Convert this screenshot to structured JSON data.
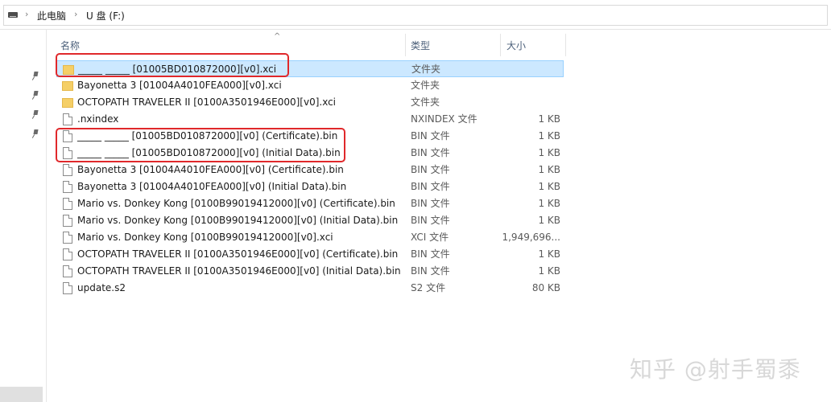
{
  "address": {
    "crumbs": [
      "此电脑",
      "U 盘 (F:)"
    ]
  },
  "columns": {
    "name": "名称",
    "type": "类型",
    "size": "大小"
  },
  "files": [
    {
      "name": "_____ _____ [01005BD010872000][v0].xci",
      "type": "文件夹",
      "size": "",
      "kind": "folder",
      "selected": true
    },
    {
      "name": "Bayonetta 3 [01004A4010FEA000][v0].xci",
      "type": "文件夹",
      "size": "",
      "kind": "folder"
    },
    {
      "name": "OCTOPATH TRAVELER II [0100A3501946E000][v0].xci",
      "type": "文件夹",
      "size": "",
      "kind": "folder"
    },
    {
      "name": ".nxindex",
      "type": "NXINDEX 文件",
      "size": "1 KB",
      "kind": "file"
    },
    {
      "name": "_____ _____ [01005BD010872000][v0] (Certificate).bin",
      "type": "BIN 文件",
      "size": "1 KB",
      "kind": "file"
    },
    {
      "name": "_____ _____ [01005BD010872000][v0] (Initial Data).bin",
      "type": "BIN 文件",
      "size": "1 KB",
      "kind": "file"
    },
    {
      "name": "Bayonetta 3 [01004A4010FEA000][v0] (Certificate).bin",
      "type": "BIN 文件",
      "size": "1 KB",
      "kind": "file"
    },
    {
      "name": "Bayonetta 3 [01004A4010FEA000][v0] (Initial Data).bin",
      "type": "BIN 文件",
      "size": "1 KB",
      "kind": "file"
    },
    {
      "name": "Mario vs. Donkey Kong [0100B99019412000][v0] (Certificate).bin",
      "type": "BIN 文件",
      "size": "1 KB",
      "kind": "file"
    },
    {
      "name": "Mario vs. Donkey Kong [0100B99019412000][v0] (Initial Data).bin",
      "type": "BIN 文件",
      "size": "1 KB",
      "kind": "file"
    },
    {
      "name": "Mario vs. Donkey Kong [0100B99019412000][v0].xci",
      "type": "XCI 文件",
      "size": "1,949,696...",
      "kind": "file"
    },
    {
      "name": "OCTOPATH TRAVELER II [0100A3501946E000][v0] (Certificate).bin",
      "type": "BIN 文件",
      "size": "1 KB",
      "kind": "file"
    },
    {
      "name": "OCTOPATH TRAVELER II [0100A3501946E000][v0] (Initial Data).bin",
      "type": "BIN 文件",
      "size": "1 KB",
      "kind": "file"
    },
    {
      "name": "update.s2",
      "type": "S2 文件",
      "size": "80 KB",
      "kind": "file"
    }
  ],
  "watermark": "知乎 @射手蜀黍",
  "colors": {
    "selection": "#cce8ff",
    "annotation": "#e0282b",
    "folder": "#f5cf67"
  }
}
